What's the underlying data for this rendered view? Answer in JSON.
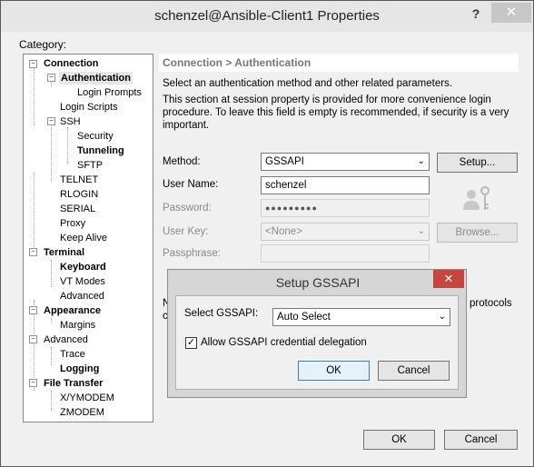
{
  "window": {
    "title": "schenzel@Ansible-Client1 Properties",
    "help_label": "?",
    "close_label": "✕"
  },
  "category_label": "Category:",
  "tree": [
    {
      "label": "Connection",
      "bold": true
    },
    {
      "label": "Authentication",
      "bold": true
    },
    {
      "label": "Login Prompts"
    },
    {
      "label": "Login Scripts"
    },
    {
      "label": "SSH"
    },
    {
      "label": "Security"
    },
    {
      "label": "Tunneling",
      "bold": true
    },
    {
      "label": "SFTP"
    },
    {
      "label": "TELNET"
    },
    {
      "label": "RLOGIN"
    },
    {
      "label": "SERIAL"
    },
    {
      "label": "Proxy"
    },
    {
      "label": "Keep Alive"
    },
    {
      "label": "Terminal",
      "bold": true
    },
    {
      "label": "Keyboard",
      "bold": true
    },
    {
      "label": "VT Modes"
    },
    {
      "label": "Advanced"
    },
    {
      "label": "Appearance",
      "bold": true
    },
    {
      "label": "Margins"
    },
    {
      "label": "Advanced"
    },
    {
      "label": "Trace"
    },
    {
      "label": "Logging",
      "bold": true
    },
    {
      "label": "File Transfer",
      "bold": true
    },
    {
      "label": "X/YMODEM"
    },
    {
      "label": "ZMODEM"
    }
  ],
  "header": "Connection > Authentication",
  "description": {
    "line1": "Select an authentication method and other related parameters.",
    "line2": "This section at session property is provided for more convenience login",
    "line3": "procedure. To leave this field is empty is recommended, if security is a very",
    "line4": "important."
  },
  "form": {
    "method_label": "Method:",
    "method_value": "GSSAPI",
    "setup_button": "Setup...",
    "username_label": "User Name:",
    "username_value": "schenzel",
    "password_label": "Password:",
    "password_value": "●●●●●●●●●",
    "userkey_label": "User Key:",
    "userkey_value": "<None>",
    "browse_button": "Browse...",
    "passphrase_label": "Passphrase:"
  },
  "behind_text": {
    "left_n": "N",
    "left_c": "c",
    "right": "protocols"
  },
  "dialog": {
    "title": "Setup GSSAPI",
    "close_label": "✕",
    "select_label": "Select GSSAPI:",
    "select_value": "Auto Select",
    "checkbox_label": "Allow GSSAPI credential delegation",
    "checkbox_checked": true,
    "ok_button": "OK",
    "cancel_button": "Cancel"
  },
  "footer": {
    "ok_button": "OK",
    "cancel_button": "Cancel"
  },
  "colors": {
    "close_red": "#c7463b",
    "tree_selected": "#e6e6e6"
  }
}
